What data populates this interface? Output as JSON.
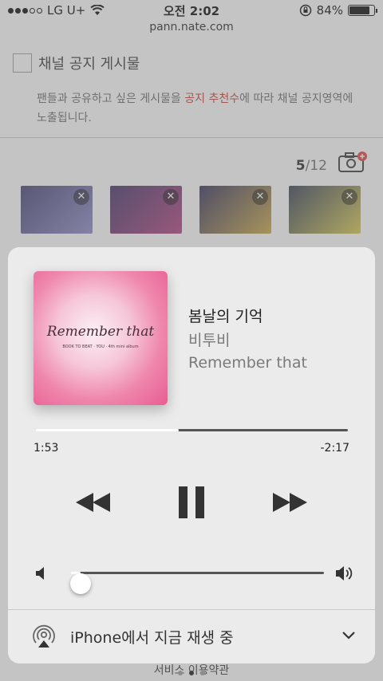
{
  "status_bar": {
    "carrier": "LG U+",
    "time": "오전 2:02",
    "battery": "84%",
    "battery_level": 0.84
  },
  "browser": {
    "url": "pann.nate.com"
  },
  "notice": {
    "title": "채널 공지 게시물",
    "desc_before": "팬들과 공유하고 싶은 게시물을 ",
    "desc_highlight": "공지 추천수",
    "desc_after": "에 따라 채널 공지영역에 노출됩니다."
  },
  "photos": {
    "count_current": "5",
    "count_total": "/12",
    "thumbs": [
      {
        "colors": [
          "#3c3a6e",
          "#8a88c8"
        ]
      },
      {
        "colors": [
          "#3a2a63",
          "#b03a7a"
        ]
      },
      {
        "colors": [
          "#2d2a56",
          "#c9a640"
        ]
      },
      {
        "colors": [
          "#2e3a52",
          "#d8c84a"
        ]
      }
    ],
    "close_symbol": "✕"
  },
  "footer": {
    "link": "서비스 이용약관"
  },
  "player": {
    "artwork_title": "Remember that",
    "artwork_sub": "BOOK TO BEAT · YOU · 4th mini album",
    "song_title": "봄날의 기억",
    "artist": "비투비",
    "album": "Remember that",
    "elapsed": "1:53",
    "remaining": "-2:17",
    "progress": 0.46,
    "volume": 0.04,
    "output_device_label": "iPhone에서 지금 재생 중",
    "icons": {
      "rewind": "rewind-icon",
      "pause": "pause-icon",
      "forward": "fast-forward-icon",
      "volume_low": "volume-low-icon",
      "volume_high": "volume-high-icon",
      "airplay": "airplay-icon",
      "chevron": "chevron-down-icon"
    }
  }
}
